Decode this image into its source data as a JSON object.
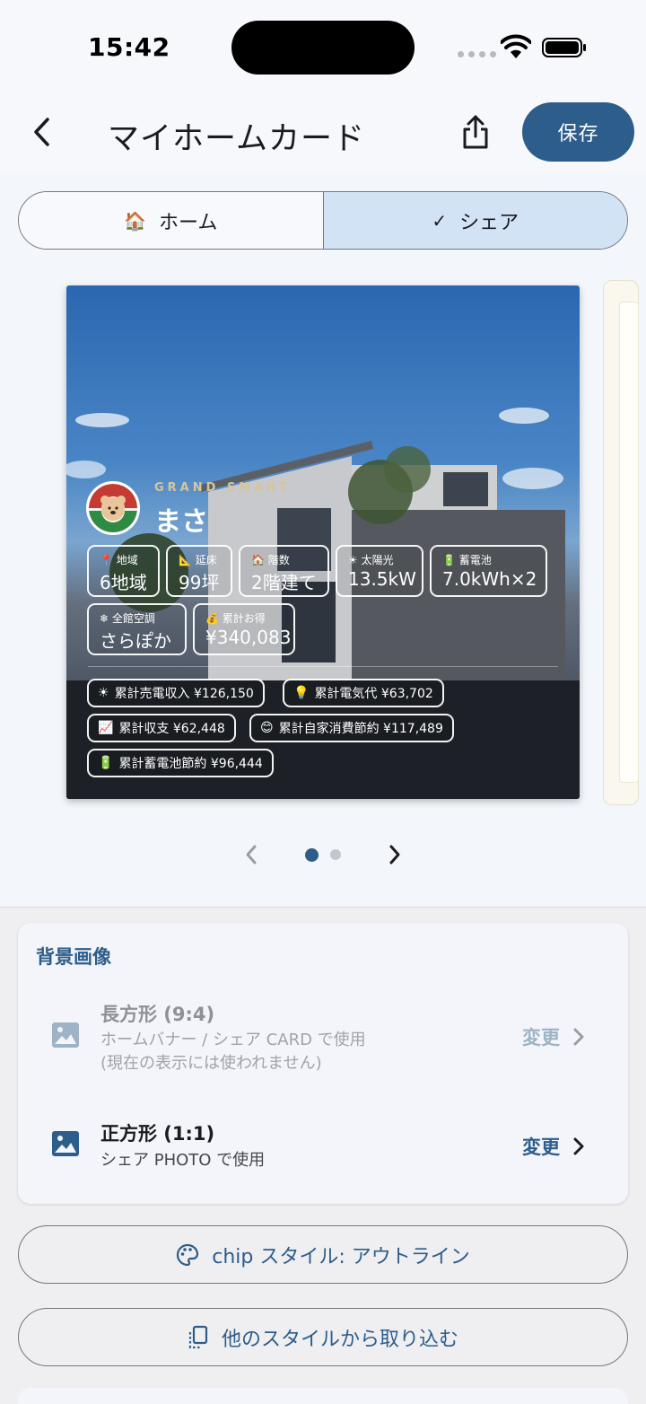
{
  "status": {
    "time": "15:42"
  },
  "appbar": {
    "title": "マイホームカード",
    "save_label": "保存"
  },
  "segments": [
    {
      "icon": "🏠",
      "label": "ホーム"
    },
    {
      "icon": "✓",
      "label": "シェア"
    }
  ],
  "card": {
    "brand": "GRAND SMART",
    "name": "まさ",
    "specs": [
      {
        "icon": "📍",
        "label": "地域",
        "value": "6地域"
      },
      {
        "icon": "📐",
        "label": "延床",
        "value": "99坪"
      },
      {
        "icon": "🏠",
        "label": "階数",
        "value": "2階建て"
      },
      {
        "icon": "☀",
        "label": "太陽光",
        "value": "13.5kW"
      },
      {
        "icon": "🔋",
        "label": "蓄電池",
        "value": "7.0kWh×2"
      },
      {
        "icon": "❄",
        "label": "全館空調",
        "value": "さらぽか"
      },
      {
        "icon": "💰",
        "label": "累計お得",
        "value": "¥340,083"
      }
    ],
    "totals": [
      {
        "icon": "☀",
        "text": "累計売電収入 ¥126,150"
      },
      {
        "icon": "💡",
        "text": "累計電気代 ¥63,702"
      },
      {
        "icon": "📈",
        "text": "累計収支 ¥62,448"
      },
      {
        "icon": "😊",
        "text": "累計自家消費節約 ¥117,489"
      },
      {
        "icon": "🔋",
        "text": "累計蓄電池節約 ¥96,444"
      }
    ]
  },
  "pager": {
    "current": 1,
    "total": 2
  },
  "background_panel": {
    "title": "背景画像",
    "options": [
      {
        "title": "長方形 (9:4)",
        "sub1": "ホームバナー / シェア CARD で使用",
        "sub2": "(現在の表示には使われません)",
        "action": "変更",
        "enabled": false
      },
      {
        "title": "正方形 (1:1)",
        "sub1": "シェア PHOTO で使用",
        "action": "変更",
        "enabled": true
      }
    ]
  },
  "buttons": {
    "chip_style": "chip スタイル: アウトライン",
    "import_style": "他のスタイルから取り込む"
  },
  "colors": {
    "primary": "#2d5d8a",
    "selected_segment": "#d3e3f6",
    "disabled_text": "#8e9196"
  }
}
